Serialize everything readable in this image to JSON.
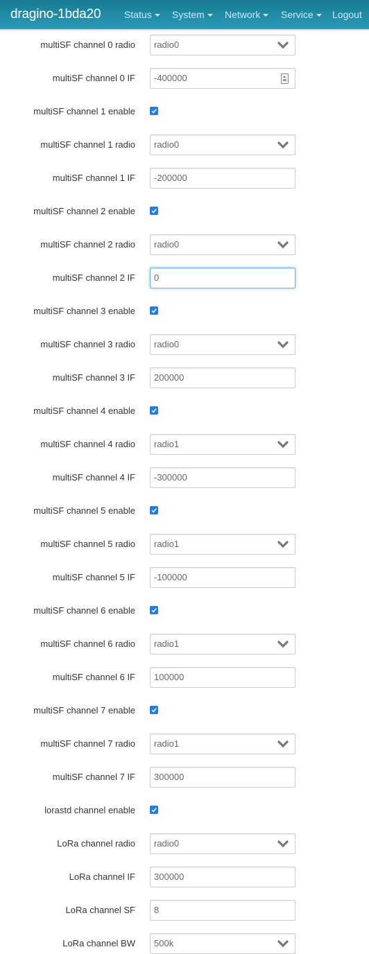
{
  "navbar": {
    "brand": "dragino-1bda20",
    "menus": [
      {
        "label": "Status",
        "dropdown": true
      },
      {
        "label": "System",
        "dropdown": true
      },
      {
        "label": "Network",
        "dropdown": true
      },
      {
        "label": "Service",
        "dropdown": true
      },
      {
        "label": "Logout",
        "dropdown": false
      }
    ]
  },
  "form": {
    "fields": [
      {
        "label": "multiSF channel 0 radio",
        "type": "select",
        "value": "radio0"
      },
      {
        "label": "multiSF channel 0 IF",
        "type": "number",
        "value": "-400000"
      },
      {
        "label": "multiSF channel 1 enable",
        "type": "checkbox",
        "checked": true
      },
      {
        "label": "multiSF channel 1 radio",
        "type": "select",
        "value": "radio0"
      },
      {
        "label": "multiSF channel 1 IF",
        "type": "text",
        "value": "-200000"
      },
      {
        "label": "multiSF channel 2 enable",
        "type": "checkbox",
        "checked": true
      },
      {
        "label": "multiSF channel 2 radio",
        "type": "select",
        "value": "radio0"
      },
      {
        "label": "multiSF channel 2 IF",
        "type": "text",
        "value": "0",
        "focused": true
      },
      {
        "label": "multiSF channel 3 enable",
        "type": "checkbox",
        "checked": true
      },
      {
        "label": "multiSF channel 3 radio",
        "type": "select",
        "value": "radio0"
      },
      {
        "label": "multiSF channel 3 IF",
        "type": "text",
        "value": "200000"
      },
      {
        "label": "multiSF channel 4 enable",
        "type": "checkbox",
        "checked": true
      },
      {
        "label": "multiSF channel 4 radio",
        "type": "select",
        "value": "radio1"
      },
      {
        "label": "multiSF channel 4 IF",
        "type": "text",
        "value": "-300000"
      },
      {
        "label": "multiSF channel 5 enable",
        "type": "checkbox",
        "checked": true
      },
      {
        "label": "multiSF channel 5 radio",
        "type": "select",
        "value": "radio1"
      },
      {
        "label": "multiSF channel 5 IF",
        "type": "text",
        "value": "-100000"
      },
      {
        "label": "multiSF channel 6 enable",
        "type": "checkbox",
        "checked": true
      },
      {
        "label": "multiSF channel 6 radio",
        "type": "select",
        "value": "radio1"
      },
      {
        "label": "multiSF channel 6 IF",
        "type": "text",
        "value": "100000"
      },
      {
        "label": "multiSF channel 7 enable",
        "type": "checkbox",
        "checked": true
      },
      {
        "label": "multiSF channel 7 radio",
        "type": "select",
        "value": "radio1"
      },
      {
        "label": "multiSF channel 7 IF",
        "type": "text",
        "value": "300000"
      },
      {
        "label": "lorastd channel enable",
        "type": "checkbox",
        "checked": true
      },
      {
        "label": "LoRa channel radio",
        "type": "select",
        "value": "radio0"
      },
      {
        "label": "LoRa channel IF",
        "type": "text",
        "value": "300000"
      },
      {
        "label": "LoRa channel SF",
        "type": "text",
        "value": "8"
      },
      {
        "label": "LoRa channel BW",
        "type": "select",
        "value": "500k"
      }
    ]
  },
  "colors": {
    "navbar_top": "#197b93",
    "navbar_bottom": "#2a9ab8",
    "checkbox": "#1f7cf0",
    "focus": "#66afe9"
  }
}
